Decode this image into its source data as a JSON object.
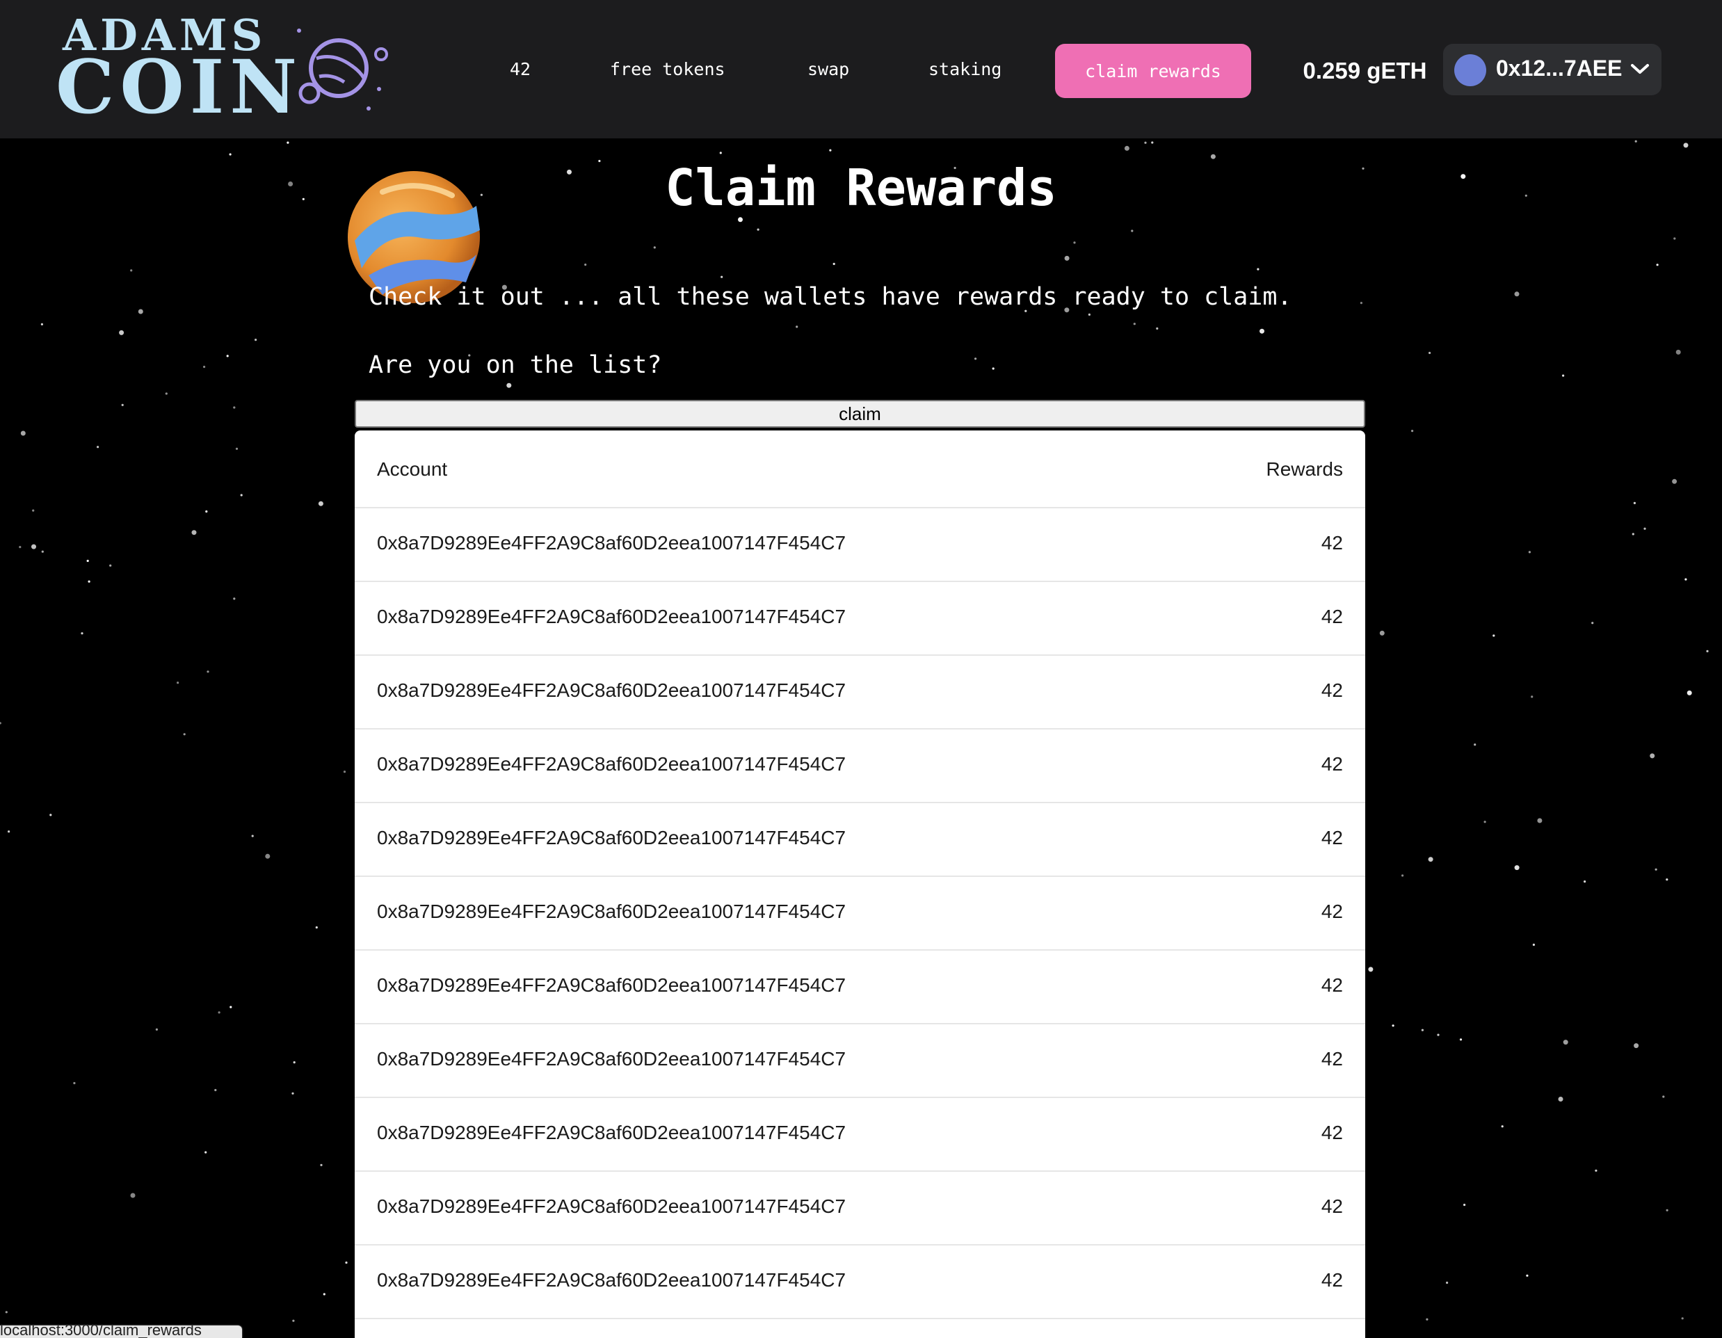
{
  "brand": {
    "logo_line1": "ADAMS",
    "logo_line2": "COIN",
    "logo_color": "#bfe3f5",
    "mark_icon": "planet-ring-icon"
  },
  "nav": {
    "items": [
      {
        "label": "42"
      },
      {
        "label": "free tokens"
      },
      {
        "label": "swap"
      },
      {
        "label": "staking"
      }
    ],
    "active_label": "claim rewards",
    "active_color": "#ef6fb4"
  },
  "wallet": {
    "balance": "0.259 gETH",
    "account": "0x12...7AEE",
    "avatar_color": "#6b7fd7"
  },
  "main": {
    "title": "Claim Rewards",
    "intro": "Check it out ... all these wallets have rewards ready to claim.",
    "question": "Are you on the list?",
    "claim_button": "claim",
    "table": {
      "headers": {
        "account": "Account",
        "rewards": "Rewards"
      },
      "rows": [
        {
          "account": "0x8a7D9289Ee4FF2A9C8af60D2eea1007147F454C7",
          "rewards": "42"
        },
        {
          "account": "0x8a7D9289Ee4FF2A9C8af60D2eea1007147F454C7",
          "rewards": "42"
        },
        {
          "account": "0x8a7D9289Ee4FF2A9C8af60D2eea1007147F454C7",
          "rewards": "42"
        },
        {
          "account": "0x8a7D9289Ee4FF2A9C8af60D2eea1007147F454C7",
          "rewards": "42"
        },
        {
          "account": "0x8a7D9289Ee4FF2A9C8af60D2eea1007147F454C7",
          "rewards": "42"
        },
        {
          "account": "0x8a7D9289Ee4FF2A9C8af60D2eea1007147F454C7",
          "rewards": "42"
        },
        {
          "account": "0x8a7D9289Ee4FF2A9C8af60D2eea1007147F454C7",
          "rewards": "42"
        },
        {
          "account": "0x8a7D9289Ee4FF2A9C8af60D2eea1007147F454C7",
          "rewards": "42"
        },
        {
          "account": "0x8a7D9289Ee4FF2A9C8af60D2eea1007147F454C7",
          "rewards": "42"
        },
        {
          "account": "0x8a7D9289Ee4FF2A9C8af60D2eea1007147F454C7",
          "rewards": "42"
        },
        {
          "account": "0x8a7D9289Ee4FF2A9C8af60D2eea1007147F454C7",
          "rewards": "42"
        }
      ]
    }
  },
  "status_url": "localhost:3000/claim_rewards"
}
